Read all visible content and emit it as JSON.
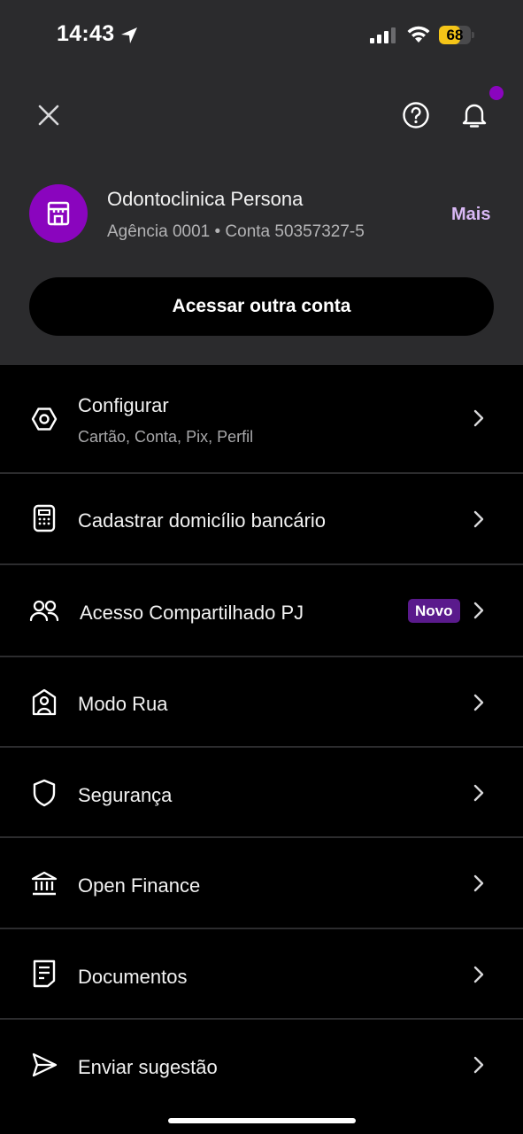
{
  "status_bar": {
    "time": "14:43",
    "battery": "68",
    "battery_level": 0.68
  },
  "colors": {
    "accent": "#8a05be",
    "accent_light": "#d9b8f5",
    "badge_bg": "#5a1a8c",
    "header_bg": "#2b2b2d"
  },
  "account": {
    "name": "Odontoclinica Persona",
    "details": "Agência 0001 • Conta 50357327-5",
    "more_label": "Mais",
    "switch_label": "Acessar outra conta",
    "avatar_icon": "store-icon"
  },
  "header": {
    "close_icon": "close-icon",
    "help_icon": "help-icon",
    "bell_icon": "bell-icon"
  },
  "menu": [
    {
      "label": "Configurar",
      "sub": "Cartão, Conta, Pix, Perfil",
      "icon": "settings-hexagon-icon"
    },
    {
      "label": "Cadastrar domicílio bancário",
      "icon": "card-terminal-icon"
    },
    {
      "label": "Acesso Compartilhado PJ",
      "badge": "Novo",
      "icon": "users-icon"
    },
    {
      "label": "Modo Rua",
      "icon": "street-mode-icon"
    },
    {
      "label": "Segurança",
      "icon": "shield-icon"
    },
    {
      "label": "Open Finance",
      "icon": "bank-icon"
    },
    {
      "label": "Documentos",
      "icon": "document-icon"
    },
    {
      "label": "Enviar sugestão",
      "icon": "send-icon"
    }
  ]
}
